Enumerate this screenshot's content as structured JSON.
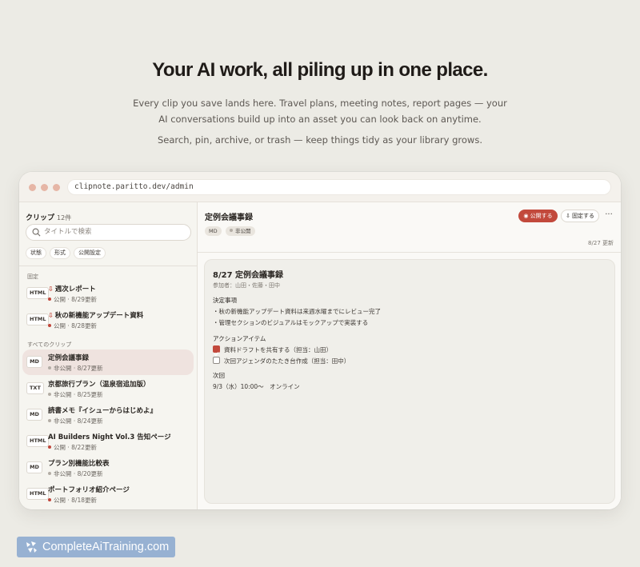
{
  "hero": {
    "title": "Your AI work, all piling up in one place.",
    "desc_line1": "Every clip you save lands here. Travel plans, meeting notes, report pages — your",
    "desc_line2": "AI conversations build up into an asset you can look back on anytime.",
    "sub": "Search, pin, archive, or trash — keep things tidy as your library grows."
  },
  "browser": {
    "url": "clipnote.paritto.dev/admin"
  },
  "sidebar": {
    "heading": "クリップ",
    "count": "12件",
    "search_placeholder": "タイトルで検索",
    "filters": [
      "状態",
      "形式",
      "公開設定"
    ],
    "pinned_label": "固定",
    "all_label": "すべてのクリップ",
    "pinned": [
      {
        "format": "HTML",
        "title": "週次レポート",
        "status": "公開",
        "updated": "8/29更新"
      },
      {
        "format": "HTML",
        "title": "秋の新機能アップデート資料",
        "status": "公開",
        "updated": "8/28更新"
      }
    ],
    "clips": [
      {
        "format": "MD",
        "title": "定例会議事録",
        "status": "非公開",
        "updated": "8/27更新"
      },
      {
        "format": "TXT",
        "title": "京都旅行プラン（温泉宿追加版）",
        "status": "非公開",
        "updated": "8/25更新"
      },
      {
        "format": "MD",
        "title": "読書メモ『イシューからはじめよ』",
        "status": "非公開",
        "updated": "8/24更新"
      },
      {
        "format": "HTML",
        "title": "AI Builders Night Vol.3 告知ページ",
        "status": "公開",
        "updated": "8/22更新"
      },
      {
        "format": "MD",
        "title": "プラン別機能比較表",
        "status": "非公開",
        "updated": "8/20更新"
      },
      {
        "format": "HTML",
        "title": "ポートフォリオ紹介ページ",
        "status": "公開",
        "updated": "8/18更新"
      }
    ]
  },
  "detail": {
    "title": "定例会議事録",
    "format_tag": "MD",
    "visibility_tag": "非公開",
    "publish_button": "公開する",
    "pin_button": "固定する",
    "more": "···",
    "updated": "8/27 更新",
    "doc": {
      "title": "8/27 定例会議事録",
      "attendees": "参加者：山田・佐藤・田中",
      "decisions_heading": "決定事項",
      "decisions": [
        "・秋の新機能アップデート資料は来週水曜までにレビュー完了",
        "・管理セクションのビジュアルはモックアップで実装する"
      ],
      "actions_heading": "アクションアイテム",
      "actions": [
        {
          "text": "資料ドラフトを共有する（担当：山田）",
          "done": true
        },
        {
          "text": "次回アジェンダのたたき台作成（担当：田中）",
          "done": false
        }
      ],
      "next_heading": "次回",
      "next": "9/3（水）10:00〜　オンライン"
    }
  },
  "watermark": {
    "text": "CompleteAiTraining.com"
  },
  "colors": {
    "accent": "#c2493c",
    "background": "#ecebe5",
    "badge": "#97b1d2"
  }
}
